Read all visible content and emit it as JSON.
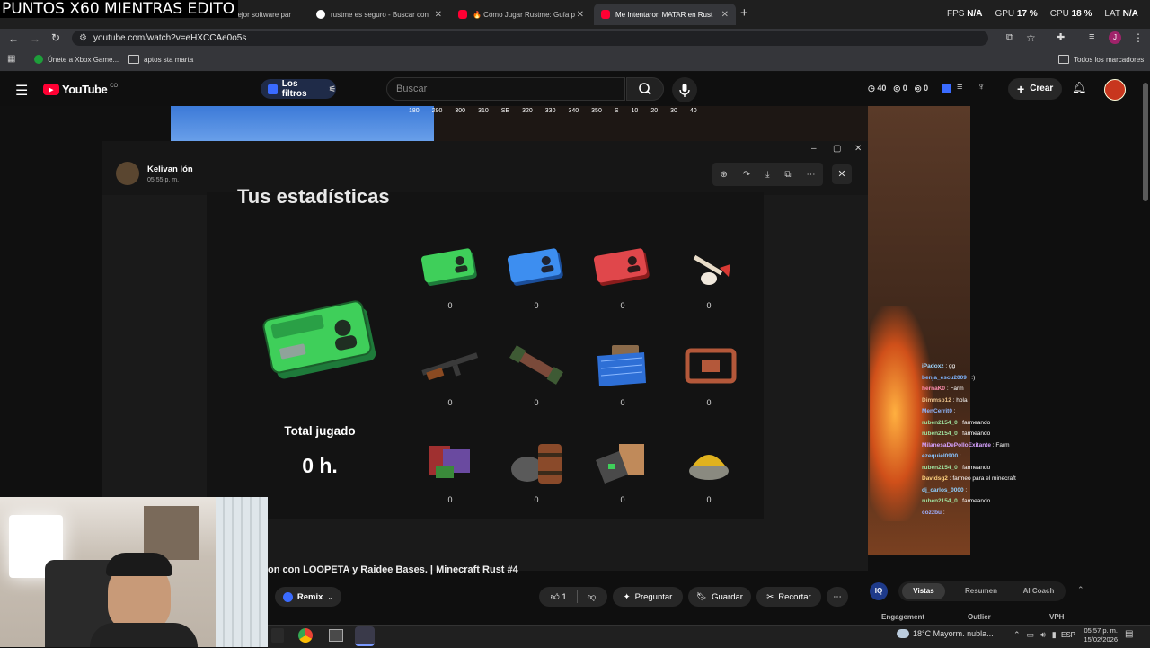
{
  "overlay": {
    "title": "PUNTOS X60 MIENTRAS EDITO"
  },
  "browser": {
    "tabs": [
      {
        "label": "nejor software par"
      },
      {
        "label": "rustme es seguro - Buscar con"
      },
      {
        "label": "🔥 Cómo Jugar Rustme: Guía p"
      },
      {
        "label": "Me Intentaron MATAR en Rust"
      }
    ],
    "new_tab": "+",
    "stats": {
      "fps_label": "FPS",
      "fps": "N/A",
      "gpu_label": "GPU",
      "gpu": "17 %",
      "cpu_label": "CPU",
      "cpu": "18 %",
      "lat_label": "LAT",
      "lat": "N/A"
    },
    "url": "youtube.com/watch?v=eHXCCAe0o5s",
    "bookmarks": [
      "Únete a Xbox Game...",
      "aptos sta marta"
    ],
    "all_bookmarks": "Todos los marcadores"
  },
  "youtube": {
    "logo": "YouTube",
    "region": "CO",
    "filters": "Los filtros",
    "search_placeholder": "Buscar",
    "counters": {
      "a": "40",
      "b": "0",
      "c": "0"
    },
    "create": "Crear"
  },
  "game_hud": {
    "compass": [
      "180",
      "290",
      "300",
      "310",
      "SE",
      "320",
      "330",
      "340",
      "350",
      "S",
      "10",
      "20",
      "30",
      "40"
    ]
  },
  "dialog": {
    "user": "Kelivan Ión",
    "time": "05:55 p. m.",
    "heading": "Tus estadísticas",
    "total_label": "Total jugado",
    "total_value": "0 h.",
    "items": [
      {
        "name": "cobalt-card-green",
        "value": "0"
      },
      {
        "name": "cobalt-card-blue",
        "value": "0"
      },
      {
        "name": "cobalt-card-red",
        "value": "0"
      },
      {
        "name": "bone-club",
        "value": "0"
      },
      {
        "name": "assault-rifle",
        "value": "0"
      },
      {
        "name": "rocket-launcher",
        "value": "0"
      },
      {
        "name": "blueprint",
        "value": "0"
      },
      {
        "name": "circuit-box",
        "value": "0"
      },
      {
        "name": "explosives-box",
        "value": "0"
      },
      {
        "name": "ore-barrel",
        "value": "0"
      },
      {
        "name": "crate",
        "value": "0"
      },
      {
        "name": "gold-ore",
        "value": "0"
      }
    ]
  },
  "chat": [
    {
      "user": "iPadoxz",
      "msg": "gg",
      "color": "#9fd6ff"
    },
    {
      "user": "benja_escu2009",
      "msg": ":)",
      "color": "#7fb5ff"
    },
    {
      "user": "hernaK0",
      "msg": "Farm",
      "color": "#ff8fb0"
    },
    {
      "user": "Dimmsp12",
      "msg": "hola",
      "color": "#e9c08a"
    },
    {
      "user": "MenCerrit0",
      "msg": "",
      "color": "#8fb7ff"
    },
    {
      "user": "ruben2154_0",
      "msg": "farmeando",
      "color": "#9fe29f"
    },
    {
      "user": "ruben2154_0",
      "msg": "farmeando",
      "color": "#9fe29f"
    },
    {
      "user": "MilanesaDePolloExitante",
      "msg": "Farm",
      "color": "#d6a2ff"
    },
    {
      "user": "ezequiel0900",
      "msg": "",
      "color": "#88c3ff"
    },
    {
      "user": "ruben2154_0",
      "msg": "farmeando",
      "color": "#9fe29f"
    },
    {
      "user": "Davidsg2",
      "msg": "farmeo para el minecraft",
      "color": "#ffd37f"
    },
    {
      "user": "dj_carlos_0000",
      "msg": "",
      "color": "#8fd0ff"
    },
    {
      "user": "ruben2154_0",
      "msg": "farmeando",
      "color": "#9fe29f"
    },
    {
      "user": "cozzbu",
      "msg": "",
      "color": "#9fb0ff"
    }
  ],
  "video_below": {
    "title": "on con LOOPETA y Raidee Bases. | Minecraft Rust #4",
    "remix": "Remix",
    "likes": "1",
    "ask": "Preguntar",
    "save": "Guardar",
    "clip": "Recortar"
  },
  "extension": {
    "tabs": [
      "Vistas",
      "Resumen",
      "AI Coach"
    ],
    "cols": [
      "Engagement",
      "Outlier",
      "VPH"
    ]
  },
  "taskbar": {
    "weather": "18°C  Mayorm. nubla...",
    "lang": "ESP",
    "time": "05:57 p. m.",
    "date": "15/02/2026"
  }
}
